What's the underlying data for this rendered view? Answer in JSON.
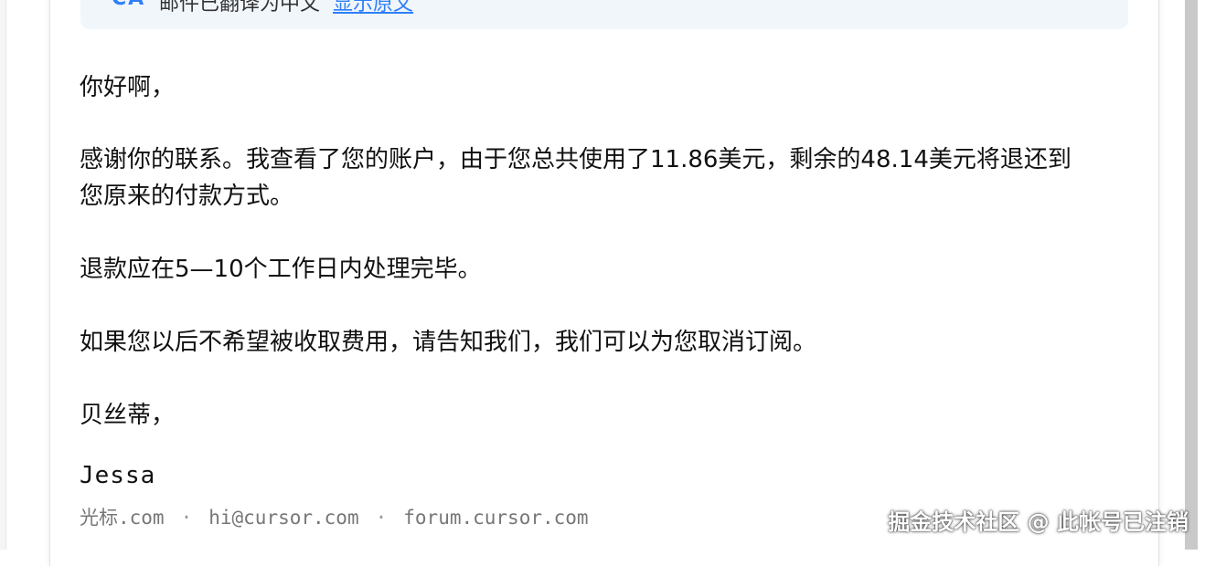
{
  "banner": {
    "icon_text": "CA",
    "message": "邮件已翻译为中文",
    "show_original_label": "显示原文"
  },
  "email": {
    "greeting": "你好啊，",
    "paragraph1_line1": "感谢你的联系。我查看了您的账户，由于您总共使用了11.86美元，剩余的48.14美元将退还到",
    "paragraph1_line2": "您原来的付款方式。",
    "paragraph2": "退款应在5—10个工作日内处理完毕。",
    "paragraph3": "如果您以后不希望被收取费用，请告知我们，我们可以为您取消订阅。",
    "closing": "贝丝蒂，",
    "signature_name": "Jessa"
  },
  "footer": {
    "link1": "光标.com",
    "separator": "·",
    "link2": "hi@cursor.com",
    "link3": "forum.cursor.com"
  },
  "watermark": "掘金技术社区 @ 此帐号已注销",
  "colors": {
    "accent": "#2d7ff9",
    "banner_bg": "#f1f6fb",
    "text": "#111111",
    "muted": "#777777"
  }
}
